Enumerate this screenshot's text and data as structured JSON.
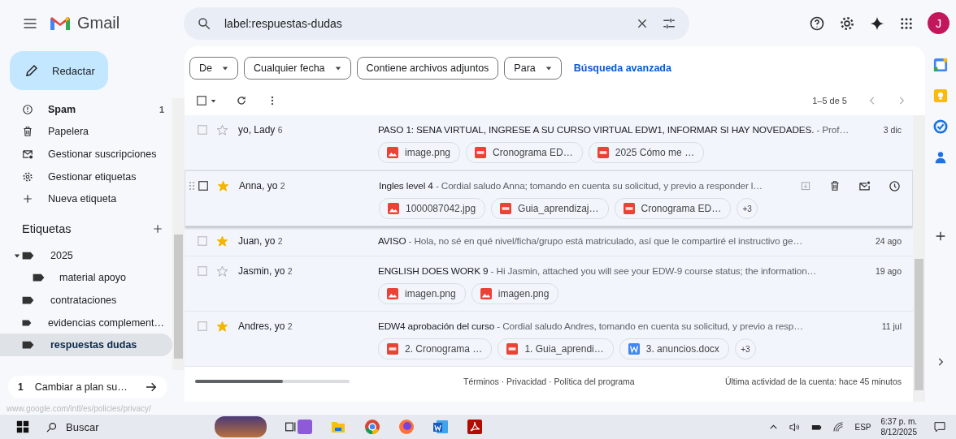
{
  "header": {
    "app_name": "Gmail",
    "search": {
      "value": "label:respuestas-dudas"
    },
    "avatar": "J"
  },
  "compose": {
    "label": "Redactar"
  },
  "sidebar": {
    "items": [
      {
        "kind": "spam",
        "label": "Spam",
        "count": "1",
        "unread": true
      },
      {
        "kind": "trash",
        "label": "Papelera",
        "unread": false
      },
      {
        "kind": "unsubscribe",
        "label": "Gestionar suscripciones",
        "unread": false
      },
      {
        "kind": "gear",
        "label": "Gestionar etiquetas",
        "unread": false
      },
      {
        "kind": "plus",
        "label": "Nueva etiqueta",
        "unread": false
      }
    ],
    "labels_heading": "Etiquetas",
    "labels": [
      {
        "name": "2025",
        "expanded": true,
        "selected": false,
        "children": [
          {
            "name": "material apoyo",
            "selected": false
          }
        ]
      },
      {
        "name": "contrataciones",
        "selected": false
      },
      {
        "name": "evidencias complement…",
        "selected": false
      },
      {
        "name": "respuestas dudas",
        "selected": true
      }
    ],
    "upgrade": {
      "number": "1",
      "label": "Cambiar a plan su…"
    }
  },
  "filters": [
    {
      "label": "De",
      "dropdown": true
    },
    {
      "label": "Cualquier fecha",
      "dropdown": true
    },
    {
      "label": "Contiene archivos adjuntos",
      "dropdown": false
    },
    {
      "label": "Para",
      "dropdown": true
    }
  ],
  "advanced_search": "Búsqueda avanzada",
  "select_all": {
    "checked": false
  },
  "pagination": "1–5 de 5",
  "emails": [
    {
      "senders": "yo, Lady",
      "count": "6",
      "starred": false,
      "hovered": false,
      "subject": "PASO 1: SENA VIRTUAL, INGRESE A SU CURSO VIRTUAL EDW1, INFORMAR SI HAY NOVEDADES.",
      "snippet": "- Prof…",
      "date": "3 dic",
      "attachments": [
        {
          "kind": "image",
          "name": "image.png"
        },
        {
          "kind": "pdf",
          "name": "Cronograma ED…"
        },
        {
          "kind": "pdf",
          "name": "2025 Cómo me …"
        }
      ]
    },
    {
      "senders": "Anna, yo",
      "count": "2",
      "starred": true,
      "hovered": true,
      "subject": "Ingles level 4",
      "snippet": "- Cordial saludo Anna; tomando en cuenta su solicitud, y previo a responder l…",
      "attachments": [
        {
          "kind": "image",
          "name": "1000087042.jpg"
        },
        {
          "kind": "pdf",
          "name": "Guia_aprendizaj…"
        },
        {
          "kind": "pdf",
          "name": "Cronograma ED…"
        }
      ],
      "more": "+3"
    },
    {
      "senders": "Juan, yo",
      "count": "2",
      "starred": true,
      "hovered": false,
      "subject": "AVISO",
      "snippet": "- Hola, no sé en qué nivel/ficha/grupo está matriculado, así que le compartiré el instructivo ge…",
      "date": "24 ago"
    },
    {
      "senders": "Jasmin, yo",
      "count": "2",
      "starred": false,
      "hovered": false,
      "subject": "ENGLISH DOES WORK 9",
      "snippet": "- Hi Jasmin, attached you will see your EDW-9 course status; the information…",
      "date": "19 ago",
      "attachments": [
        {
          "kind": "image",
          "name": "imagen.png"
        },
        {
          "kind": "image",
          "name": "imagen.png"
        }
      ]
    },
    {
      "senders": "Andres, yo",
      "count": "2",
      "starred": true,
      "hovered": false,
      "subject": "EDW4 aprobación del curso",
      "snippet": "- Cordial saludo Andres, tomando en cuenta su solicitud, y previo a resp…",
      "date": "11 jul",
      "attachments": [
        {
          "kind": "pdf",
          "name": "2. Cronograma …"
        },
        {
          "kind": "pdf",
          "name": "1. Guia_aprendi…"
        },
        {
          "kind": "word",
          "name": "3. anuncios.docx"
        }
      ],
      "more": "+3"
    }
  ],
  "footer": {
    "storage": {
      "level": 0.57
    },
    "links": "Términos · Privacidad · Política del programa",
    "activity": "Última actividad de la cuenta: hace 45 minutos"
  },
  "status_url": "www.google.com/intl/es/policies/privacy/",
  "taskbar": {
    "search": "Buscar",
    "language": "ESP",
    "time": "6:37 p. m.",
    "date": "8/12/2025"
  }
}
